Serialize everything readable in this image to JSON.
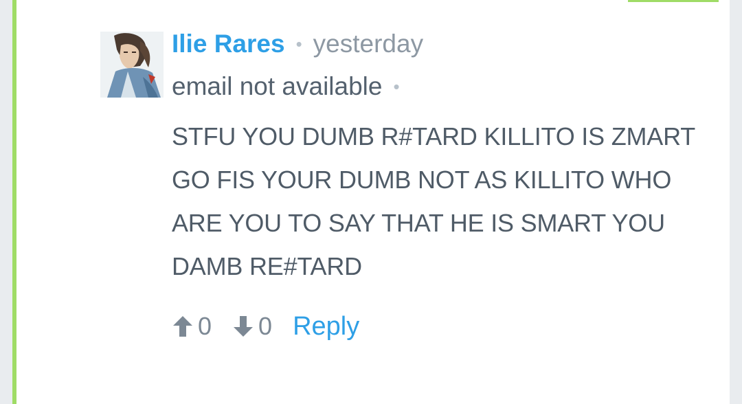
{
  "comment": {
    "author": "Ilie Rares",
    "separator": "•",
    "time": "yesterday",
    "email": "email not available",
    "body_lines": [
      "STFU YOU DUMB R#TARD KILLITO IS ZMART",
      "GO FIS YOUR DUMB NOT AS KILLITO WHO",
      "ARE YOU TO SAY THAT HE IS SMART YOU",
      "DAMB RE#TARD"
    ],
    "upvotes": "0",
    "downvotes": "0",
    "reply_label": "Reply",
    "avatar_icon": "avatar-illustration",
    "upvote_icon": "arrow-up-icon",
    "downvote_icon": "arrow-down-icon"
  },
  "colors": {
    "accent_border": "#9fdc66",
    "author_link": "#2e9fe6",
    "body_text": "#4f5b67",
    "muted_text": "#8d98a3"
  }
}
